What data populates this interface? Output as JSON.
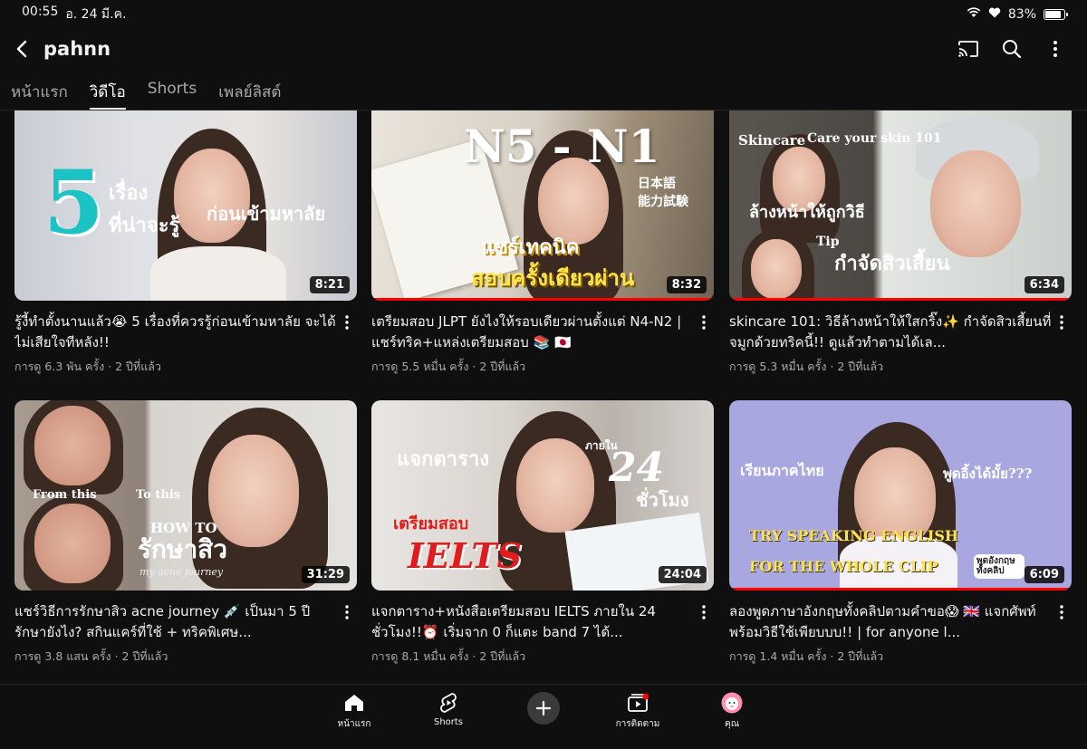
{
  "status": {
    "time": "00:55",
    "date": "อ. 24 มี.ค.",
    "battery": "83%",
    "battery_level": 0.83
  },
  "header": {
    "channel_name": "pahnn"
  },
  "tabs": [
    {
      "label": "หน้าแรก"
    },
    {
      "label": "วิดีโอ",
      "active": true
    },
    {
      "label": "Shorts"
    },
    {
      "label": "เพลย์ลิสต์"
    }
  ],
  "videos": [
    {
      "title": "รู้งี้ทำตั้งนานแล้ว😭 5 เรื่องที่ควรรู้ก่อนเข้ามหาลัย จะได้ไม่เสียใจทีหลัง!!",
      "stats": "การดู 6.3 พัน ครั้ง · 2 ปีที่แล้ว",
      "duration": "8:21",
      "thumb_text": [
        "5",
        "เรื่อง",
        "ที่น่าจะรู้",
        "ก่อนเข้ามหาลัย"
      ],
      "progress": 0
    },
    {
      "title": "เตรียมสอบ JLPT ยังไงให้รอบเดียวผ่านตั้งแต่ N4-N2 | แชร์ทริค+แหล่งเตรียมสอบ 📚 🇯🇵",
      "stats": "การดู 5.5 หมื่น ครั้ง · 2 ปีที่แล้ว",
      "duration": "8:32",
      "thumb_text": [
        "N5 - N1",
        "日本語",
        "能力試験",
        "แชร์เทคนิค",
        "สอบครั้งเดียวผ่าน"
      ],
      "progress": 1
    },
    {
      "title": "skincare 101: วิธีล้างหน้าให้ใสกริ๊ง✨ กำจัดสิวเสี้ยนที่จมูกด้วยทริคนี้!! ดูแล้วทำตามได้เล...",
      "stats": "การดู 5.3 หมื่น ครั้ง · 2 ปีที่แล้ว",
      "duration": "6:34",
      "thumb_text": [
        "Skincare",
        "Care your skin 101",
        "ล้างหน้าให้ถูกวิธี",
        "Tip",
        "กำจัดสิวเสี้ยน"
      ],
      "progress": 1
    },
    {
      "title": "แชร์วิธีการรักษาสิว acne journey 💉 เป็นมา 5 ปีรักษายังไง? สกินแคร์ที่ใช้ + ทริคพิเศษ...",
      "stats": "การดู 3.8 แสน ครั้ง · 2 ปีที่แล้ว",
      "duration": "31:29",
      "thumb_text": [
        "From this",
        "To this",
        "HOW TO",
        "รักษาสิว",
        "my acne journey"
      ],
      "progress": 0
    },
    {
      "title": "แจกตาราง+หนังสือเตรียมสอบ IELTS ภายใน 24 ชั่วโมง!!⏰ เริ่มจาก 0 ก็แตะ band 7 ได้...",
      "stats": "การดู 8.1 หมื่น ครั้ง · 2 ปีที่แล้ว",
      "duration": "24:04",
      "thumb_text": [
        "แจกตาราง",
        "ภายใน",
        "24",
        "ชั่วโมง",
        "เตรียมสอบ",
        "IELTS"
      ],
      "progress": 0
    },
    {
      "title": "ลองพูดภาษาอังกฤษทั้งคลิปตามคำขอ😱 🇬🇧 แจกศัพท์พร้อมวิธีใช้เพียบบบ!! | for anyone l...",
      "stats": "การดู 1.4 หมื่น ครั้ง · 2 ปีที่แล้ว",
      "duration": "6:09",
      "thumb_text": [
        "เรียนภาคไทย",
        "พูดอิ้งได้มั้ย???",
        "TRY SPEAKING ENGLISH",
        "FOR THE WHOLE CLIP",
        "พูดอังกฤษทั้งคลิป"
      ],
      "progress": 1
    }
  ],
  "bottom_nav": {
    "home": "หน้าแรก",
    "shorts": "Shorts",
    "subscriptions": "การติดตาม",
    "you": "คุณ"
  },
  "colors": {
    "background": "#0f0f0f",
    "accent": "#ff0000",
    "secondary_text": "#aaaaaa"
  }
}
